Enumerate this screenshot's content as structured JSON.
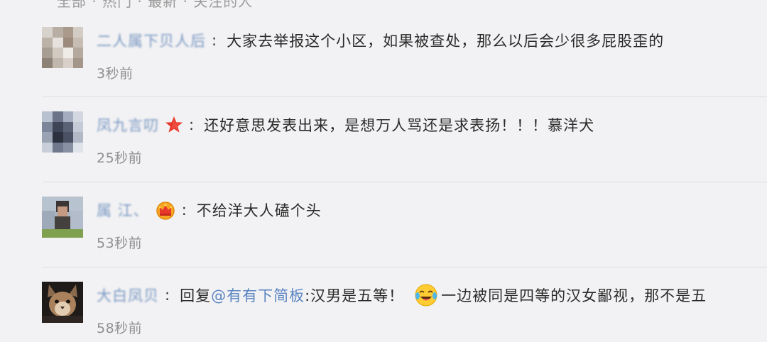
{
  "top_filter": {
    "text": "全部 · 热门 · 最新 · 关注的人"
  },
  "comments": [
    {
      "username": "二人属下贝人后",
      "content": "大家去举报这个小区，如果被查处，那么以后会少很多屁股歪的",
      "time": "3秒前",
      "badge": ""
    },
    {
      "username": "凤九言叨",
      "content": "还好意思发表出来，是想万人骂还是求表扬！！！慕洋犬",
      "time": "25秒前",
      "badge": "red-star-icon"
    },
    {
      "username": "属 江、",
      "content": "不给洋大人磕个头",
      "time": "53秒前",
      "badge": "crown-badge-icon"
    },
    {
      "username": "大白凤贝",
      "reply_prefix": "回复",
      "mention": "@有有下简板",
      "content": ":汉男是五等！",
      "emoji": "laughing-crying-emoji",
      "content_after": "一边被同是四等的汉女鄙视，那不是五",
      "time": "58秒前"
    }
  ],
  "colors": {
    "background": "#f2f2f4",
    "username": "#7a98c2",
    "mention": "#5b85c2",
    "text": "#2a2a2a",
    "time": "#8f8f8f",
    "divider": "#dedee2"
  }
}
